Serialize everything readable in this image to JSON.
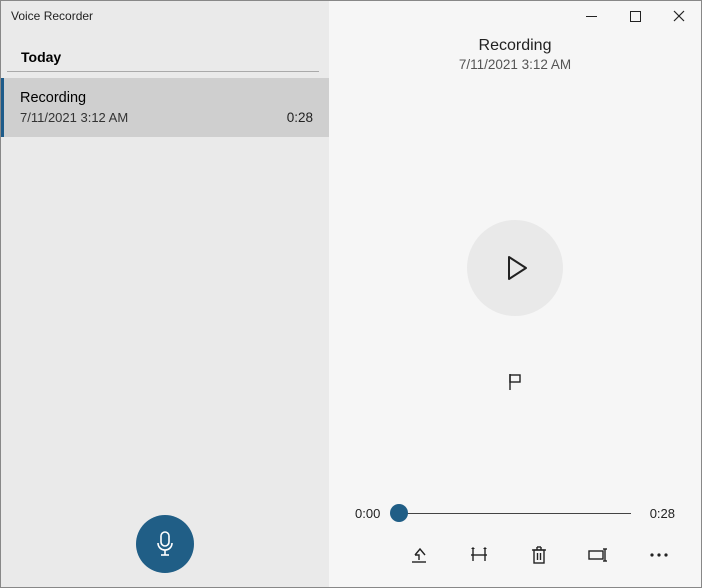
{
  "app_title": "Voice Recorder",
  "sidebar": {
    "section_label": "Today",
    "items": [
      {
        "name": "Recording",
        "date": "7/11/2021 3:12 AM",
        "duration": "0:28"
      }
    ]
  },
  "detail": {
    "name": "Recording",
    "date": "7/11/2021 3:12 AM",
    "current_time": "0:00",
    "total_time": "0:28"
  },
  "colors": {
    "accent": "#205e86"
  }
}
